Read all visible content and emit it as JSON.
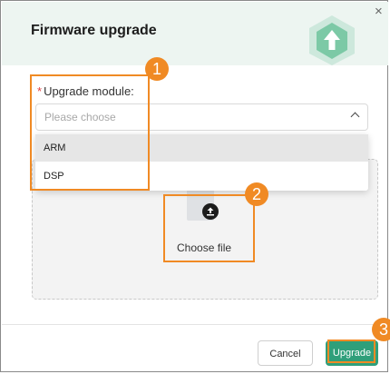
{
  "dialog": {
    "title": "Firmware upgrade",
    "close_glyph": "×",
    "header_icon": "upgrade-hexagon-icon"
  },
  "form": {
    "required_mark": "*",
    "module_label": "Upgrade module:",
    "select_placeholder": "Please choose",
    "options": [
      {
        "label": "ARM",
        "highlighted": true
      },
      {
        "label": "DSP",
        "highlighted": false
      }
    ]
  },
  "upload": {
    "icon": "upload-icon",
    "choose_label": "Choose file"
  },
  "footer": {
    "cancel_label": "Cancel",
    "upgrade_label": "Upgrade"
  },
  "callouts": [
    "1",
    "2",
    "3"
  ],
  "colors": {
    "accent": "#2f9f7a",
    "callout": "#f08a24",
    "header_bg": "#edf5f1",
    "required": "#e04040"
  }
}
